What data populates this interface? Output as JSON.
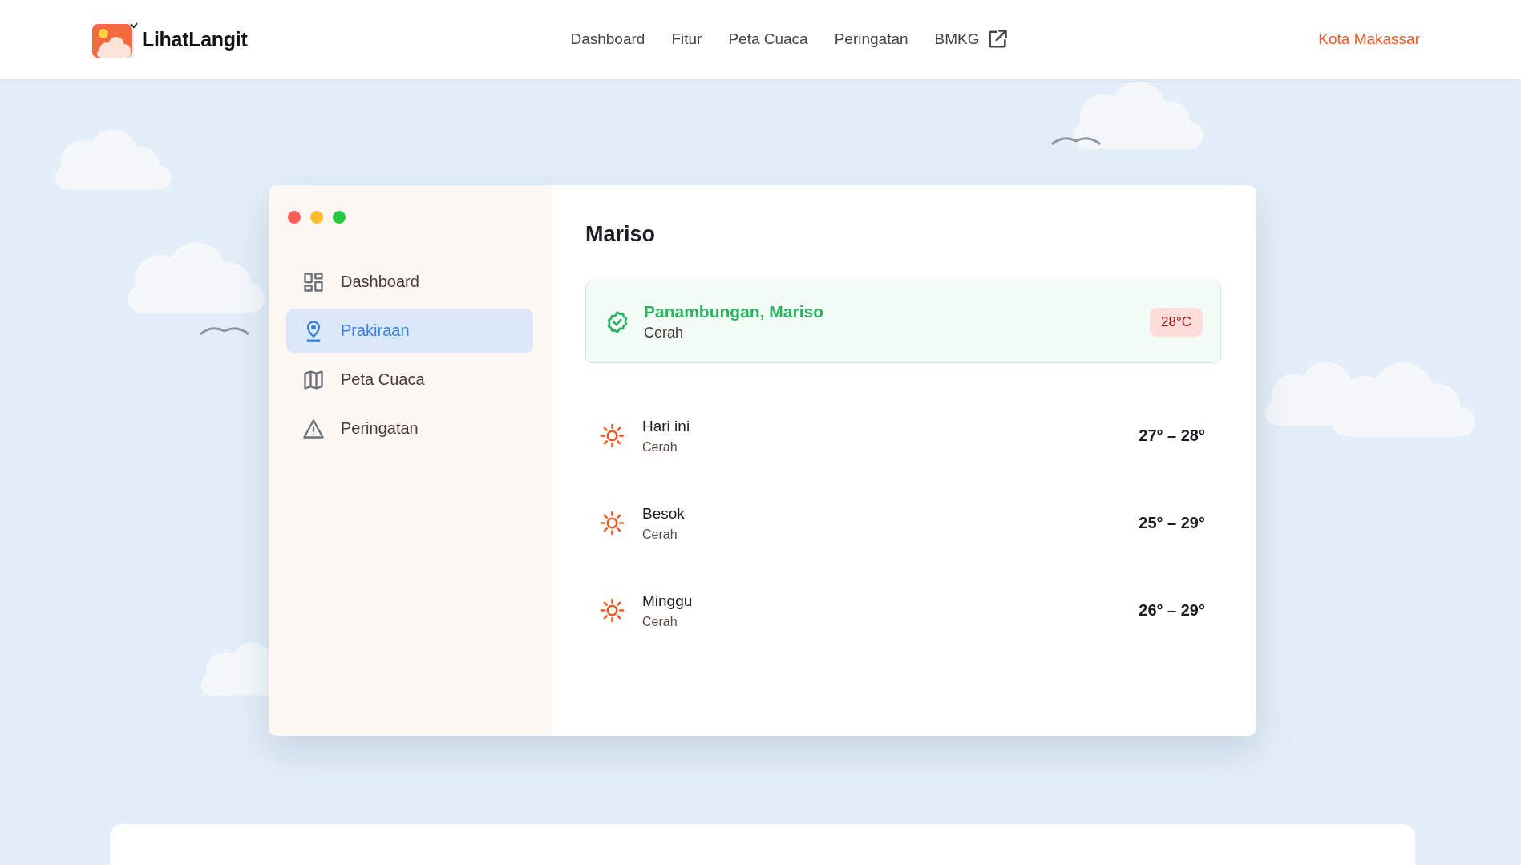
{
  "header": {
    "brand": "LihatLangit",
    "nav": [
      {
        "label": "Dashboard",
        "kind": "link"
      },
      {
        "label": "Fitur",
        "kind": "link"
      },
      {
        "label": "Peta Cuaca",
        "kind": "link"
      },
      {
        "label": "Peringatan",
        "kind": "link"
      },
      {
        "label": "BMKG",
        "kind": "external"
      }
    ],
    "city": "Kota Makassar"
  },
  "sidebar": {
    "items": [
      {
        "label": "Dashboard",
        "kind": "grid",
        "selected": false
      },
      {
        "label": "Prakiraan",
        "kind": "pin",
        "selected": true
      },
      {
        "label": "Peta Cuaca",
        "kind": "map",
        "selected": false
      },
      {
        "label": "Peringatan",
        "kind": "warning",
        "selected": false
      }
    ]
  },
  "main": {
    "title": "Mariso",
    "current": {
      "location": "Panambungan, Mariso",
      "condition": "Cerah",
      "temperature": "28°C"
    },
    "forecast": [
      {
        "day": "Hari ini",
        "condition": "Cerah",
        "kind": "sun",
        "range": "27° – 28°"
      },
      {
        "day": "Besok",
        "condition": "Cerah",
        "kind": "sun",
        "range": "25° – 29°"
      },
      {
        "day": "Minggu",
        "condition": "Cerah",
        "kind": "sun",
        "range": "26° – 29°"
      }
    ]
  }
}
